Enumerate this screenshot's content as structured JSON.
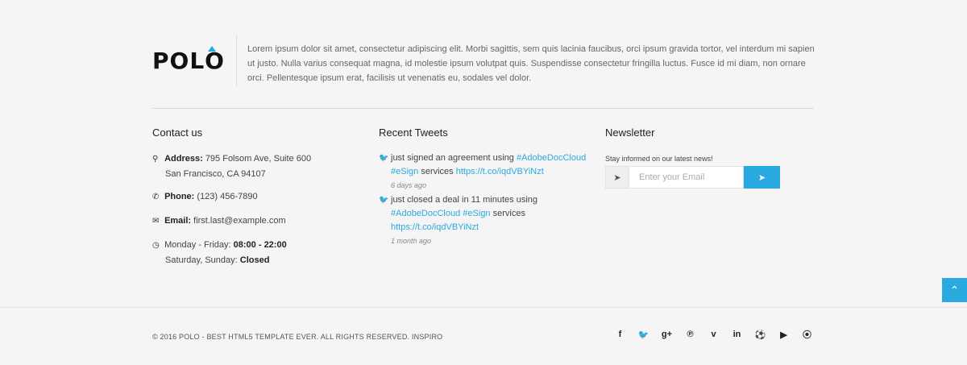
{
  "brand": {
    "logo_text_1": "POL",
    "logo_text_2": "O"
  },
  "about": {
    "text": "Lorem ipsum dolor sit amet, consectetur adipiscing elit. Morbi sagittis, sem quis lacinia faucibus, orci ipsum gravida tortor, vel interdum mi sapien ut justo. Nulla varius consequat magna, id molestie ipsum volutpat quis. Suspendisse consectetur fringilla luctus. Fusce id mi diam, non ornare orci. Pellentesque ipsum erat, facilisis ut venenatis eu, sodales vel dolor."
  },
  "contact": {
    "title": "Contact us",
    "address_label": "Address:",
    "address_line1": "795 Folsom Ave, Suite 600",
    "address_line2": "San Francisco, CA 94107",
    "phone_label": "Phone:",
    "phone": "(123) 456-7890",
    "email_label": "Email:",
    "email": "first.last@example.com",
    "hours_weekday_label": "Monday - Friday:",
    "hours_weekday": "08:00 - 22:00",
    "hours_weekend_label": "Saturday, Sunday:",
    "hours_weekend": "Closed"
  },
  "tweets": {
    "title": "Recent Tweets",
    "items": [
      {
        "pre": "just signed an agreement using",
        "tag1": "#AdobeDocCloud",
        "tag2": "#eSign",
        "mid": "services",
        "link": "https://t.co/iqdVBYiNzt",
        "time": "6 days ago"
      },
      {
        "pre": "just closed a deal in 11 minutes using",
        "tag1": "#AdobeDocCloud",
        "tag2": "#eSign",
        "mid": "services",
        "link": "https://t.co/iqdVBYiNzt",
        "time": "1 month ago"
      }
    ]
  },
  "newsletter": {
    "title": "Newsletter",
    "caption": "Stay informed on our latest news!",
    "placeholder": "Enter your Email"
  },
  "footer": {
    "copyright": "© 2016 POLO - BEST HTML5 TEMPLATE EVER. ALL RIGHTS RESERVED. INSPIRO"
  },
  "social": {
    "facebook": "f",
    "twitter": "🐦",
    "google_plus": "g+",
    "pinterest": "℗",
    "vimeo": "v",
    "linkedin": "in",
    "dribbble": "⚽",
    "youtube": "▶",
    "rss": "⦿"
  },
  "colors": {
    "accent": "#2aa9e0",
    "background": "#f5f5f5"
  }
}
